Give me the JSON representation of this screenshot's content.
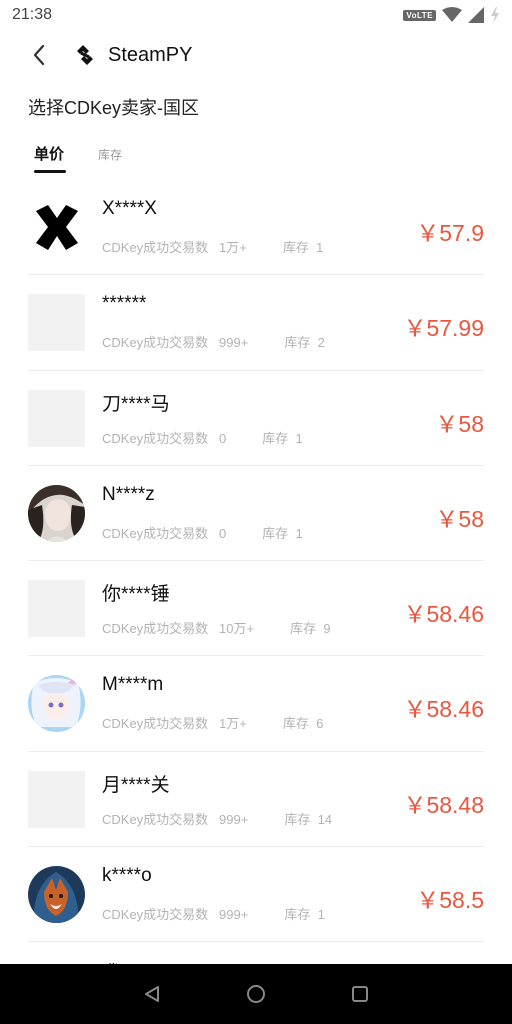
{
  "status_bar": {
    "time": "21:38",
    "volte": "VoLTE"
  },
  "header": {
    "title": "SteamPY"
  },
  "subtitle": "选择CDKey卖家-国区",
  "tabs": [
    {
      "label": "单价",
      "active": true
    },
    {
      "label": "库存",
      "active": false
    }
  ],
  "meta_label": "CDKey成功交易数",
  "stock_label": "库存",
  "sellers": [
    {
      "name": "X****X",
      "trades": "1万+",
      "stock": "1",
      "price": "￥57.9",
      "avatar": "x-logo"
    },
    {
      "name": "******",
      "trades": "999+",
      "stock": "2",
      "price": "￥57.99",
      "avatar": "placeholder"
    },
    {
      "name": "刀****马",
      "trades": "0",
      "stock": "1",
      "price": "￥58",
      "avatar": "placeholder"
    },
    {
      "name": "N****z",
      "trades": "0",
      "stock": "1",
      "price": "￥58",
      "avatar": "photo-girl"
    },
    {
      "name": "你****锤",
      "trades": "10万+",
      "stock": "9",
      "price": "￥58.46",
      "avatar": "placeholder"
    },
    {
      "name": "M****m",
      "trades": "1万+",
      "stock": "6",
      "price": "￥58.46",
      "avatar": "anime-girl"
    },
    {
      "name": "月****关",
      "trades": "999+",
      "stock": "14",
      "price": "￥58.48",
      "avatar": "placeholder"
    },
    {
      "name": "k****o",
      "trades": "999+",
      "stock": "1",
      "price": "￥58.5",
      "avatar": "fox-hood"
    }
  ],
  "partial_seller": {
    "name": "我****"
  },
  "colors": {
    "price": "#e9573f",
    "placeholder": "#f2f2f2",
    "nav": "#000000"
  }
}
